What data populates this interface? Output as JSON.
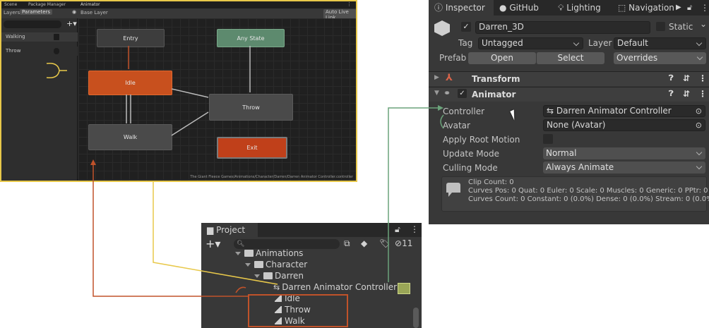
{
  "animator": {
    "tabs": [
      "Scene",
      "Package Manager",
      "Animator"
    ],
    "layers_tab": "Layers",
    "parameters_tab": "Parameters",
    "breadcrumb": "Base Layer",
    "auto_live_link": "Auto Live Link",
    "parameters": [
      "Walking",
      "Throw"
    ],
    "states": {
      "entry": "Entry",
      "any_state": "Any State",
      "idle": "Idle",
      "throw": "Throw",
      "walk": "Walk",
      "exit": "Exit"
    },
    "path": "The Giant Fleece Games/Animations/Character/Darren/Darren Animator Controller.controller",
    "colors": {
      "idle_state": "#c8501e",
      "exit_state": "#c0401a",
      "any_state": "#5d8a6e",
      "entry_state": "#3d3d3d"
    }
  },
  "inspector": {
    "tabs": [
      "Inspector",
      "GitHub",
      "Lighting",
      "Navigation"
    ],
    "object_name": "Darren_3D",
    "static_label": "Static",
    "tag_label": "Tag",
    "tag_value": "Untagged",
    "layer_label": "Layer",
    "layer_value": "Default",
    "prefab_label": "Prefab",
    "open_button": "Open",
    "select_button": "Select",
    "overrides_button": "Overrides",
    "transform_title": "Transform",
    "animator_title": "Animator",
    "controller_label": "Controller",
    "controller_value": "Darren Animator Controller",
    "avatar_label": "Avatar",
    "avatar_value": "None (Avatar)",
    "apply_root_motion_label": "Apply Root Motion",
    "update_mode_label": "Update Mode",
    "update_mode_value": "Normal",
    "culling_mode_label": "Culling Mode",
    "culling_mode_value": "Always Animate",
    "info_lines": [
      "Clip Count: 0",
      "Curves Pos: 0 Quat: 0 Euler: 0 Scale: 0 Muscles: 0 Generic: 0 PPtr: 0",
      "Curves Count: 0 Constant: 0 (0.0%) Dense: 0 (0.0%) Stream: 0 (0.0%)"
    ]
  },
  "project": {
    "tab_label": "Project",
    "hidden_count": "11",
    "items": [
      {
        "label": "Animations",
        "kind": "folder"
      },
      {
        "label": "Character",
        "kind": "folder"
      },
      {
        "label": "Darren",
        "kind": "folder"
      },
      {
        "label": "Darren Animator Controller",
        "kind": "controller"
      },
      {
        "label": "Idle",
        "kind": "clip"
      },
      {
        "label": "Throw",
        "kind": "clip"
      },
      {
        "label": "Walk",
        "kind": "clip"
      }
    ]
  },
  "annotation_colors": {
    "animator_link": "#e8c84a",
    "clips_link": "#c0522a",
    "controller_link": "#6aa37a"
  }
}
